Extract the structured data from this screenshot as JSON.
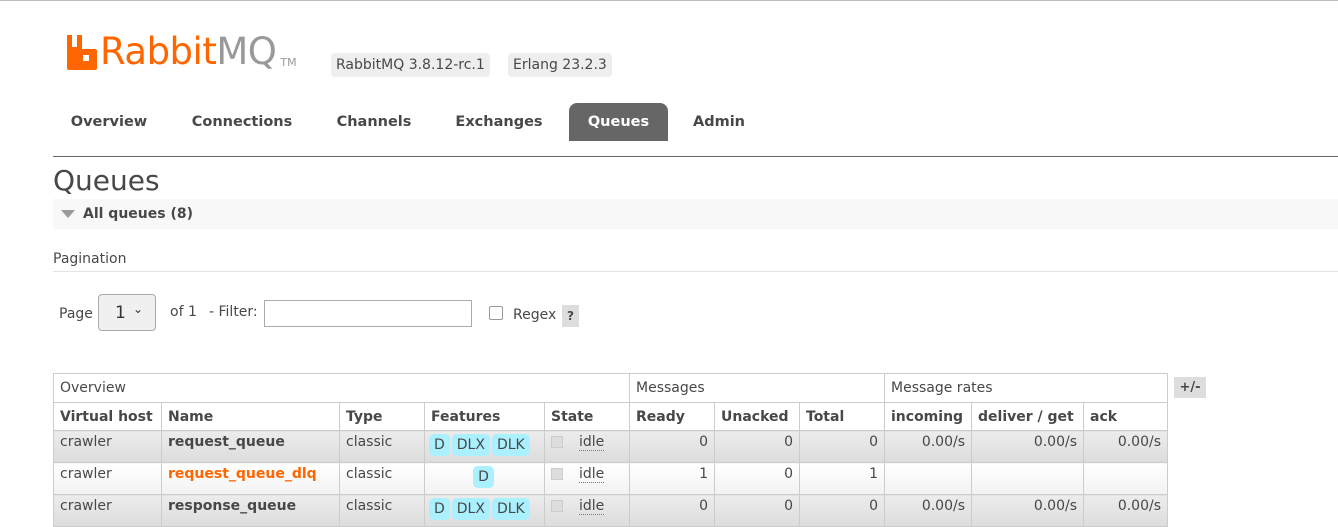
{
  "header": {
    "logo_rabbit": "Rabbit",
    "logo_mq": "MQ",
    "logo_tm": "TM",
    "rabbitmq_version": "RabbitMQ 3.8.12-rc.1",
    "erlang_version": "Erlang 23.2.3",
    "brand_color": "#ff6600"
  },
  "tabs": [
    {
      "label": "Overview",
      "active": false
    },
    {
      "label": "Connections",
      "active": false
    },
    {
      "label": "Channels",
      "active": false
    },
    {
      "label": "Exchanges",
      "active": false
    },
    {
      "label": "Queues",
      "active": true
    },
    {
      "label": "Admin",
      "active": false
    }
  ],
  "page_title": "Queues",
  "section": {
    "label": "All queues (8)"
  },
  "pagination": {
    "title": "Pagination",
    "page_label": "Page",
    "page_value": "1",
    "of_label": "of 1",
    "filter_label": "- Filter:",
    "filter_value": "",
    "regex_label": "Regex",
    "regex_checked": false,
    "help_label": "?"
  },
  "table": {
    "group_headers": [
      "Overview",
      "Messages",
      "Message rates"
    ],
    "columns_toggle": "+/-",
    "headers": [
      "Virtual host",
      "Name",
      "Type",
      "Features",
      "State",
      "Ready",
      "Unacked",
      "Total",
      "incoming",
      "deliver / get",
      "ack"
    ],
    "rows": [
      {
        "vhost": "crawler",
        "name": "request_queue",
        "type": "classic",
        "features": [
          "D",
          "DLX",
          "DLK"
        ],
        "state": "idle",
        "ready": "0",
        "unacked": "0",
        "total": "0",
        "incoming": "0.00/s",
        "deliver": "0.00/s",
        "ack": "0.00/s",
        "highlight": false
      },
      {
        "vhost": "crawler",
        "name": "request_queue_dlq",
        "type": "classic",
        "features": [
          "D"
        ],
        "state": "idle",
        "ready": "1",
        "unacked": "0",
        "total": "1",
        "incoming": "",
        "deliver": "",
        "ack": "",
        "highlight": true
      },
      {
        "vhost": "crawler",
        "name": "response_queue",
        "type": "classic",
        "features": [
          "D",
          "DLX",
          "DLK"
        ],
        "state": "idle",
        "ready": "0",
        "unacked": "0",
        "total": "0",
        "incoming": "0.00/s",
        "deliver": "0.00/s",
        "ack": "0.00/s",
        "highlight": false
      }
    ]
  }
}
